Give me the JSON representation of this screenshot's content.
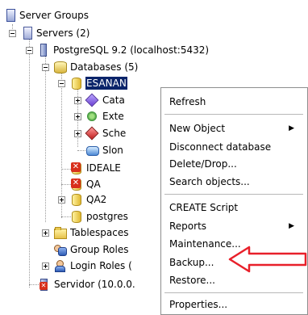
{
  "tree": {
    "server_groups": "Server Groups",
    "servers": "Servers (2)",
    "postgres_server": "PostgreSQL 9.2 (localhost:5432)",
    "databases": "Databases (5)",
    "db_esanan": "ESANAN",
    "catalogs": "Cata",
    "extensions": "Exte",
    "schemas": "Sche",
    "slony": "Slon",
    "db_ideale": "IDEALE",
    "db_qa": "QA",
    "db_qa2": "QA2",
    "db_postgres": "postgres",
    "tablespaces": "Tablespaces",
    "group_roles": "Group Roles",
    "login_roles": "Login Roles (",
    "servidor": "Servidor (10.0.0."
  },
  "context_menu": {
    "refresh": "Refresh",
    "new_object": "New Object",
    "disconnect": "Disconnect database",
    "delete": "Delete/Drop...",
    "search": "Search objects...",
    "create_script": "CREATE Script",
    "reports": "Reports",
    "maintenance": "Maintenance...",
    "backup": "Backup...",
    "restore": "Restore...",
    "properties": "Properties..."
  },
  "colors": {
    "selection": "#0a246a",
    "annotation_arrow": "#e8202a"
  },
  "icons": {
    "submenu_arrow": "▶"
  }
}
